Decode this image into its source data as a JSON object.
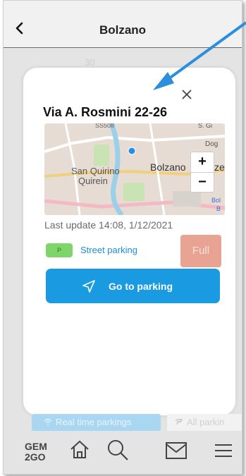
{
  "header": {
    "title": "Bolzano",
    "back_icon": "chevron-left-icon"
  },
  "background": {
    "number": "30"
  },
  "card": {
    "close_icon": "close-icon",
    "street": "Via A. Rosmini 22-26",
    "map": {
      "labels": {
        "road": "SS508",
        "san_quirino": "San Quirino",
        "quirein": "Quirein",
        "bolzano": "Bolzano",
        "ze": "ze",
        "s_gi": "S. Gi",
        "dog": "Dog",
        "bol": "Bol",
        "b": "B"
      },
      "zoom_in": "+",
      "zoom_out": "−"
    },
    "last_update": "Last update 14:08, 1/12/2021",
    "parking_badge": "P",
    "parking_type": "Street parking",
    "status": "Full",
    "go_button": "Go to parking",
    "go_icon": "navigation-arrow-icon"
  },
  "tabs": {
    "realtime": "Real time parkings",
    "all": "All parkin"
  },
  "bottom_nav": {
    "logo_line1": "GEM",
    "logo_line2": "2GO",
    "items": [
      "home-icon",
      "search-icon",
      "mail-icon",
      "menu-icon"
    ]
  },
  "colors": {
    "primary": "#1a9ae0",
    "full_status": "#e8a392",
    "badge_green": "#7ed66b",
    "annotation_arrow": "#2d8fdc"
  }
}
